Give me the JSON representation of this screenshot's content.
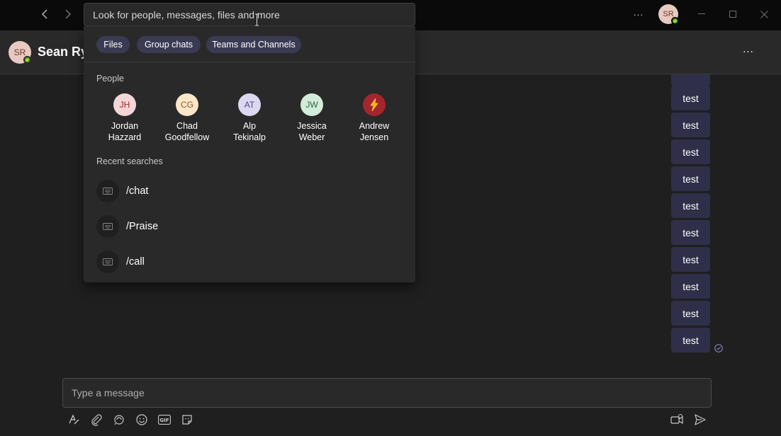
{
  "titlebar": {
    "search_placeholder": "Look for people, messages, files and more",
    "user_initials": "SR",
    "more_label": "..."
  },
  "header": {
    "avatar_initials": "SR",
    "name": "Sean Ry",
    "more_label": "..."
  },
  "search_dropdown": {
    "chips": [
      "Files",
      "Group chats",
      "Teams and Channels"
    ],
    "people_title": "People",
    "people": [
      {
        "initials": "JH",
        "first": "Jordan",
        "last": "Hazzard",
        "bg": "#f3d6d8",
        "fg": "#a4262c"
      },
      {
        "initials": "CG",
        "first": "Chad",
        "last": "Goodfellow",
        "bg": "#fde7c8",
        "fg": "#8e562e"
      },
      {
        "initials": "AT",
        "first": "Alp",
        "last": "Tekinalp",
        "bg": "#dcd8f0",
        "fg": "#4f4a85"
      },
      {
        "initials": "JW",
        "first": "Jessica",
        "last": "Weber",
        "bg": "#d3ebdb",
        "fg": "#2d6a3f"
      },
      {
        "initials": "",
        "first": "Andrew",
        "last": "Jensen",
        "bg": "#a4262c",
        "fg": "#f7b500"
      }
    ],
    "recent_title": "Recent searches",
    "recent": [
      "/chat",
      "/Praise",
      "/call"
    ]
  },
  "messages": [
    "test",
    "test",
    "test",
    "test",
    "test",
    "test",
    "test",
    "test",
    "test",
    "test"
  ],
  "compose": {
    "placeholder": "Type a message"
  },
  "colors": {
    "accent": "#2f2f4a",
    "chip": "#3a3a52",
    "presence": "#6bb700",
    "read_receipt": "#8b8cc7"
  }
}
